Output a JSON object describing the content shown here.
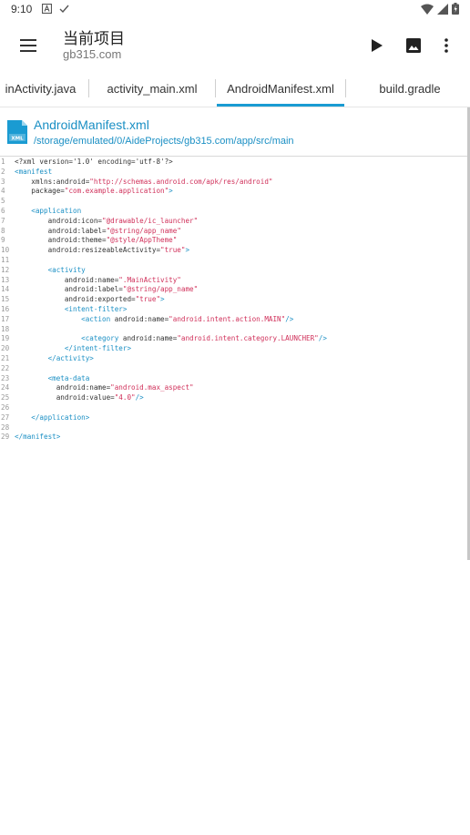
{
  "status_bar": {
    "time": "9:10"
  },
  "toolbar": {
    "title": "当前项目",
    "subtitle": "gb315.com"
  },
  "tabs": [
    {
      "label": "inActivity.java"
    },
    {
      "label": "activity_main.xml"
    },
    {
      "label": "AndroidManifest.xml",
      "active": true
    },
    {
      "label": "build.gradle"
    }
  ],
  "file": {
    "name": "AndroidManifest.xml",
    "path": "/storage/emulated/0/AideProjects/gb315.com/app/src/main",
    "icon_text": "XML"
  },
  "colors": {
    "accent": "#1a9bd2",
    "tag": "#1a8fc4",
    "value": "#d0305a"
  },
  "code_lines": [
    {
      "n": "1",
      "parts": [
        [
          "a",
          "<?xml version='1.0' encoding='utf-8'?>"
        ]
      ]
    },
    {
      "n": "2",
      "parts": [
        [
          "t",
          "<manifest"
        ]
      ]
    },
    {
      "n": "3",
      "parts": [
        [
          "a",
          "    xmlns:android="
        ],
        [
          "v",
          "\"http://schemas.android.com/apk/res/android\""
        ]
      ]
    },
    {
      "n": "4",
      "parts": [
        [
          "a",
          "    package="
        ],
        [
          "v",
          "\"com.example.application\""
        ],
        [
          "t",
          ">"
        ]
      ]
    },
    {
      "n": "5",
      "parts": []
    },
    {
      "n": "6",
      "parts": [
        [
          "t",
          "    <application"
        ]
      ]
    },
    {
      "n": "7",
      "parts": [
        [
          "a",
          "        android:icon="
        ],
        [
          "v",
          "\"@drawable/ic_launcher\""
        ]
      ]
    },
    {
      "n": "8",
      "parts": [
        [
          "a",
          "        android:label="
        ],
        [
          "v",
          "\"@string/app_name\""
        ]
      ]
    },
    {
      "n": "9",
      "parts": [
        [
          "a",
          "        android:theme="
        ],
        [
          "v",
          "\"@style/AppTheme\""
        ]
      ]
    },
    {
      "n": "10",
      "parts": [
        [
          "a",
          "        android:resizeableActivity="
        ],
        [
          "v",
          "\"true\""
        ],
        [
          "t",
          ">"
        ]
      ]
    },
    {
      "n": "11",
      "parts": []
    },
    {
      "n": "12",
      "parts": [
        [
          "t",
          "        <activity"
        ]
      ]
    },
    {
      "n": "13",
      "parts": [
        [
          "a",
          "            android:name="
        ],
        [
          "v",
          "\".MainActivity\""
        ]
      ]
    },
    {
      "n": "14",
      "parts": [
        [
          "a",
          "            android:label="
        ],
        [
          "v",
          "\"@string/app_name\""
        ]
      ]
    },
    {
      "n": "15",
      "parts": [
        [
          "a",
          "            android:exported="
        ],
        [
          "v",
          "\"true\""
        ],
        [
          "t",
          ">"
        ]
      ]
    },
    {
      "n": "16",
      "parts": [
        [
          "t",
          "            <intent-filter>"
        ]
      ]
    },
    {
      "n": "17",
      "parts": [
        [
          "t",
          "                <action "
        ],
        [
          "a",
          "android:name="
        ],
        [
          "v",
          "\"android.intent.action.MAIN\""
        ],
        [
          "t",
          "/>"
        ]
      ]
    },
    {
      "n": "18",
      "parts": []
    },
    {
      "n": "19",
      "parts": [
        [
          "t",
          "                <category "
        ],
        [
          "a",
          "android:name="
        ],
        [
          "v",
          "\"android.intent.category.LAUNCHER\""
        ],
        [
          "t",
          "/>"
        ]
      ]
    },
    {
      "n": "20",
      "parts": [
        [
          "t",
          "            </intent-filter>"
        ]
      ]
    },
    {
      "n": "21",
      "parts": [
        [
          "t",
          "        </activity>"
        ]
      ]
    },
    {
      "n": "22",
      "parts": []
    },
    {
      "n": "23",
      "parts": [
        [
          "t",
          "        <meta-data"
        ]
      ]
    },
    {
      "n": "24",
      "parts": [
        [
          "a",
          "          android:name="
        ],
        [
          "v",
          "\"android.max_aspect\""
        ]
      ]
    },
    {
      "n": "25",
      "parts": [
        [
          "a",
          "          android:value="
        ],
        [
          "v",
          "\"4.0\""
        ],
        [
          "t",
          "/>"
        ]
      ]
    },
    {
      "n": "26",
      "parts": []
    },
    {
      "n": "27",
      "parts": [
        [
          "t",
          "    </application>"
        ]
      ]
    },
    {
      "n": "28",
      "parts": []
    },
    {
      "n": "29",
      "parts": [
        [
          "t",
          "</manifest>"
        ]
      ]
    }
  ]
}
